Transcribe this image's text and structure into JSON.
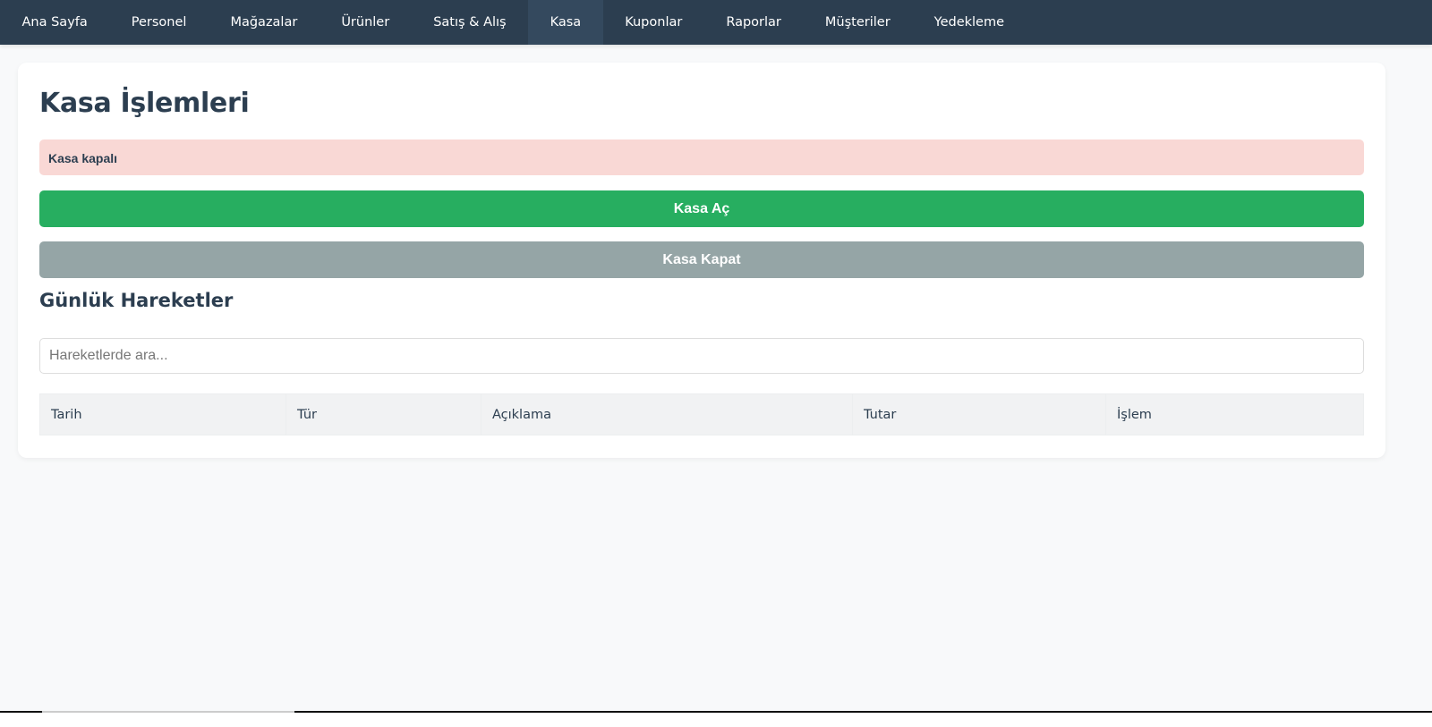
{
  "nav": {
    "items": [
      "Ana Sayfa",
      "Personel",
      "Mağazalar",
      "Ürünler",
      "Satış & Alış",
      "Kasa",
      "Kuponlar",
      "Raporlar",
      "Müşteriler",
      "Yedekleme"
    ],
    "active": "Kasa"
  },
  "page": {
    "title": "Kasa İşlemleri",
    "status": "Kasa kapalı",
    "open_button": "Kasa Aç",
    "close_button": "Kasa Kapat",
    "section_title": "Günlük Hareketler",
    "search_placeholder": "Hareketlerde ara..."
  },
  "table": {
    "headers": [
      "Tarih",
      "Tür",
      "Açıklama",
      "Tutar",
      "İşlem"
    ],
    "rows": []
  },
  "colors": {
    "nav": "#2c3e50",
    "green": "#27ae60",
    "gray": "#95a5a6",
    "alert": "#f9d8d5"
  }
}
